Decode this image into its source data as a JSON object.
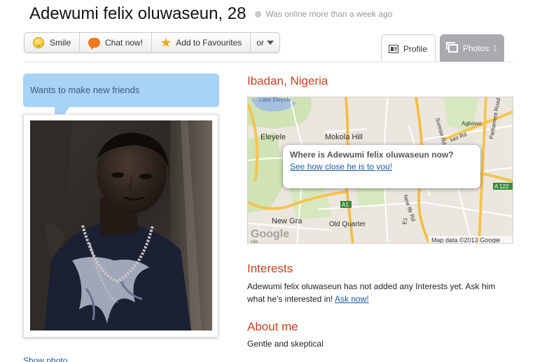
{
  "profile": {
    "name_age": "Adewumi felix oluwaseun, 28",
    "online_status": "Was online more than a week ago",
    "status_bubble": "Wants to make new friends",
    "show_photo_link": "Show photo"
  },
  "actions": {
    "smile": "Smile",
    "chat": "Chat now!",
    "favourites": "Add to Favourites",
    "more": "or"
  },
  "tabs": {
    "profile": "Profile",
    "photos": "Photos",
    "photos_count": "1"
  },
  "location": {
    "title": "Ibadan, Nigeria",
    "popup_question": "Where is Adewumi felix oluwaseun now?",
    "popup_link": "See how close he is to you!",
    "map_labels": {
      "lake": "Lake Eleyele",
      "eleyele": "Eleyele",
      "mokola": "Mokola Hill",
      "new_gra": "New Gra",
      "old_quarter": "Old Quarter",
      "iwo_rd": "Iwo Rd",
      "agbowo": "Agbowo",
      "parliament": "Parliament Road",
      "sunrise": "Sunrise Rd",
      "new_ife": "New Ife Rd",
      "a1": "A1",
      "e1": "E1",
      "a122": "A 122",
      "google_logo": "Google",
      "ole": "ole",
      "attribution": "Map data ©2013 Google"
    }
  },
  "interests": {
    "title": "Interests",
    "text": "Adewumi felix oluwaseun has not added any Interests yet. Ask him what he's interested in!",
    "link": "Ask now!"
  },
  "about": {
    "title": "About me",
    "text": "Gentle and skeptical"
  },
  "colors": {
    "section_title": "#c8431d",
    "bubble": "#a8d2f6",
    "link": "#1a5aa8",
    "photos_tab": "#a9a9ae",
    "map_road_major": "#f5c451",
    "map_green": "#cfe3b4"
  }
}
